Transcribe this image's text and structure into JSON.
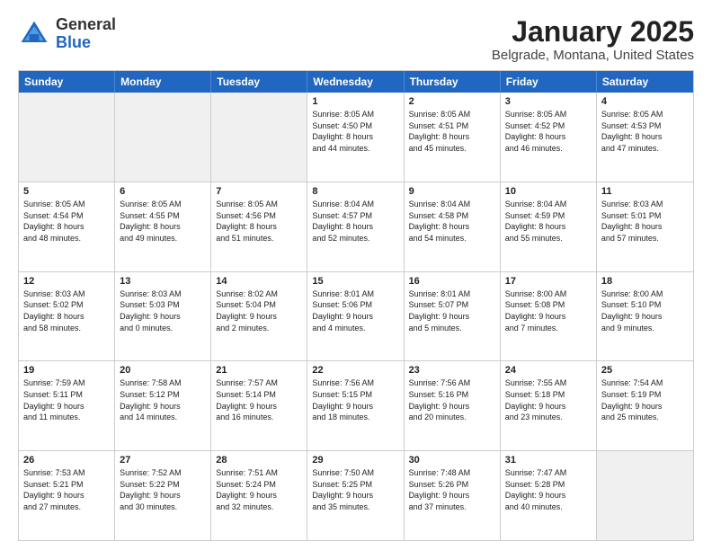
{
  "logo": {
    "general": "General",
    "blue": "Blue"
  },
  "header": {
    "title": "January 2025",
    "subtitle": "Belgrade, Montana, United States"
  },
  "weekdays": [
    "Sunday",
    "Monday",
    "Tuesday",
    "Wednesday",
    "Thursday",
    "Friday",
    "Saturday"
  ],
  "weeks": [
    [
      {
        "day": "",
        "info": "",
        "shaded": true
      },
      {
        "day": "",
        "info": "",
        "shaded": true
      },
      {
        "day": "",
        "info": "",
        "shaded": true
      },
      {
        "day": "1",
        "info": "Sunrise: 8:05 AM\nSunset: 4:50 PM\nDaylight: 8 hours\nand 44 minutes.",
        "shaded": false
      },
      {
        "day": "2",
        "info": "Sunrise: 8:05 AM\nSunset: 4:51 PM\nDaylight: 8 hours\nand 45 minutes.",
        "shaded": false
      },
      {
        "day": "3",
        "info": "Sunrise: 8:05 AM\nSunset: 4:52 PM\nDaylight: 8 hours\nand 46 minutes.",
        "shaded": false
      },
      {
        "day": "4",
        "info": "Sunrise: 8:05 AM\nSunset: 4:53 PM\nDaylight: 8 hours\nand 47 minutes.",
        "shaded": false
      }
    ],
    [
      {
        "day": "5",
        "info": "Sunrise: 8:05 AM\nSunset: 4:54 PM\nDaylight: 8 hours\nand 48 minutes.",
        "shaded": false
      },
      {
        "day": "6",
        "info": "Sunrise: 8:05 AM\nSunset: 4:55 PM\nDaylight: 8 hours\nand 49 minutes.",
        "shaded": false
      },
      {
        "day": "7",
        "info": "Sunrise: 8:05 AM\nSunset: 4:56 PM\nDaylight: 8 hours\nand 51 minutes.",
        "shaded": false
      },
      {
        "day": "8",
        "info": "Sunrise: 8:04 AM\nSunset: 4:57 PM\nDaylight: 8 hours\nand 52 minutes.",
        "shaded": false
      },
      {
        "day": "9",
        "info": "Sunrise: 8:04 AM\nSunset: 4:58 PM\nDaylight: 8 hours\nand 54 minutes.",
        "shaded": false
      },
      {
        "day": "10",
        "info": "Sunrise: 8:04 AM\nSunset: 4:59 PM\nDaylight: 8 hours\nand 55 minutes.",
        "shaded": false
      },
      {
        "day": "11",
        "info": "Sunrise: 8:03 AM\nSunset: 5:01 PM\nDaylight: 8 hours\nand 57 minutes.",
        "shaded": false
      }
    ],
    [
      {
        "day": "12",
        "info": "Sunrise: 8:03 AM\nSunset: 5:02 PM\nDaylight: 8 hours\nand 58 minutes.",
        "shaded": false
      },
      {
        "day": "13",
        "info": "Sunrise: 8:03 AM\nSunset: 5:03 PM\nDaylight: 9 hours\nand 0 minutes.",
        "shaded": false
      },
      {
        "day": "14",
        "info": "Sunrise: 8:02 AM\nSunset: 5:04 PM\nDaylight: 9 hours\nand 2 minutes.",
        "shaded": false
      },
      {
        "day": "15",
        "info": "Sunrise: 8:01 AM\nSunset: 5:06 PM\nDaylight: 9 hours\nand 4 minutes.",
        "shaded": false
      },
      {
        "day": "16",
        "info": "Sunrise: 8:01 AM\nSunset: 5:07 PM\nDaylight: 9 hours\nand 5 minutes.",
        "shaded": false
      },
      {
        "day": "17",
        "info": "Sunrise: 8:00 AM\nSunset: 5:08 PM\nDaylight: 9 hours\nand 7 minutes.",
        "shaded": false
      },
      {
        "day": "18",
        "info": "Sunrise: 8:00 AM\nSunset: 5:10 PM\nDaylight: 9 hours\nand 9 minutes.",
        "shaded": false
      }
    ],
    [
      {
        "day": "19",
        "info": "Sunrise: 7:59 AM\nSunset: 5:11 PM\nDaylight: 9 hours\nand 11 minutes.",
        "shaded": false
      },
      {
        "day": "20",
        "info": "Sunrise: 7:58 AM\nSunset: 5:12 PM\nDaylight: 9 hours\nand 14 minutes.",
        "shaded": false
      },
      {
        "day": "21",
        "info": "Sunrise: 7:57 AM\nSunset: 5:14 PM\nDaylight: 9 hours\nand 16 minutes.",
        "shaded": false
      },
      {
        "day": "22",
        "info": "Sunrise: 7:56 AM\nSunset: 5:15 PM\nDaylight: 9 hours\nand 18 minutes.",
        "shaded": false
      },
      {
        "day": "23",
        "info": "Sunrise: 7:56 AM\nSunset: 5:16 PM\nDaylight: 9 hours\nand 20 minutes.",
        "shaded": false
      },
      {
        "day": "24",
        "info": "Sunrise: 7:55 AM\nSunset: 5:18 PM\nDaylight: 9 hours\nand 23 minutes.",
        "shaded": false
      },
      {
        "day": "25",
        "info": "Sunrise: 7:54 AM\nSunset: 5:19 PM\nDaylight: 9 hours\nand 25 minutes.",
        "shaded": false
      }
    ],
    [
      {
        "day": "26",
        "info": "Sunrise: 7:53 AM\nSunset: 5:21 PM\nDaylight: 9 hours\nand 27 minutes.",
        "shaded": false
      },
      {
        "day": "27",
        "info": "Sunrise: 7:52 AM\nSunset: 5:22 PM\nDaylight: 9 hours\nand 30 minutes.",
        "shaded": false
      },
      {
        "day": "28",
        "info": "Sunrise: 7:51 AM\nSunset: 5:24 PM\nDaylight: 9 hours\nand 32 minutes.",
        "shaded": false
      },
      {
        "day": "29",
        "info": "Sunrise: 7:50 AM\nSunset: 5:25 PM\nDaylight: 9 hours\nand 35 minutes.",
        "shaded": false
      },
      {
        "day": "30",
        "info": "Sunrise: 7:48 AM\nSunset: 5:26 PM\nDaylight: 9 hours\nand 37 minutes.",
        "shaded": false
      },
      {
        "day": "31",
        "info": "Sunrise: 7:47 AM\nSunset: 5:28 PM\nDaylight: 9 hours\nand 40 minutes.",
        "shaded": false
      },
      {
        "day": "",
        "info": "",
        "shaded": true
      }
    ]
  ]
}
